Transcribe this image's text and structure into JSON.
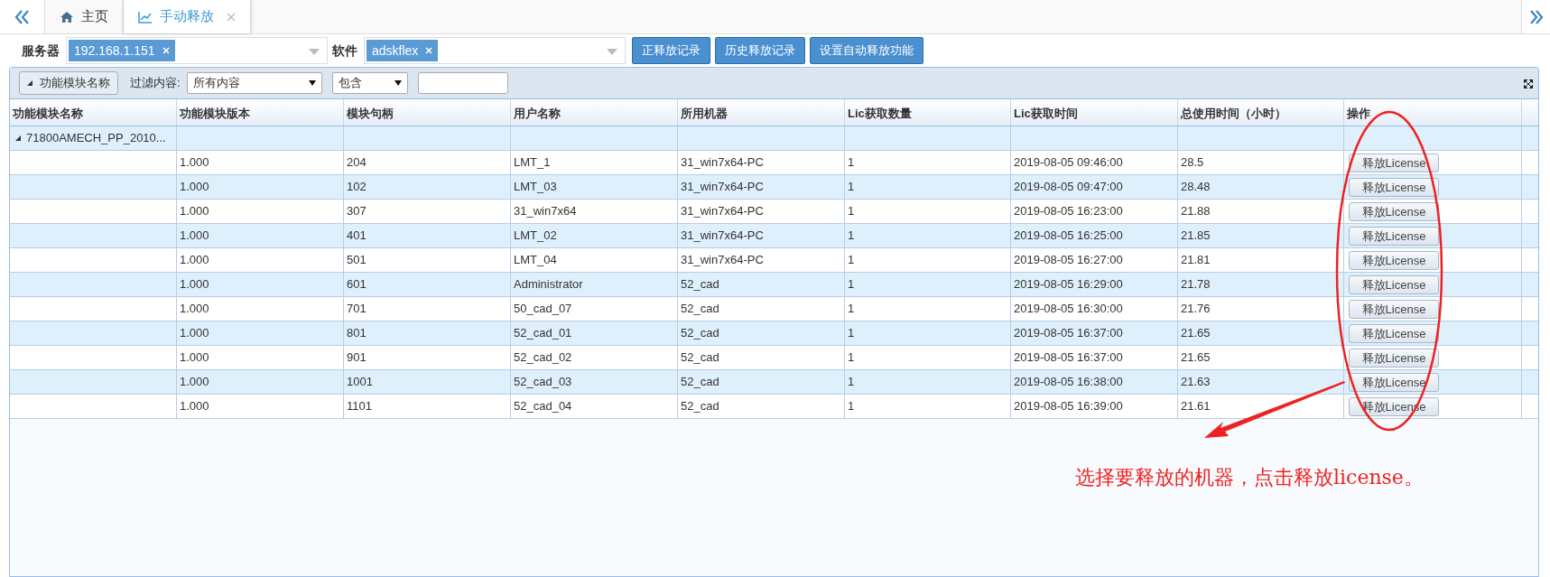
{
  "tabs": [
    {
      "label": "主页",
      "selected": false,
      "closable": false
    },
    {
      "label": "手动释放",
      "selected": true,
      "closable": true
    }
  ],
  "filters": {
    "server_label": "服务器",
    "server_tag": "192.168.1.151",
    "software_label": "软件",
    "software_tag": "adskflex",
    "buttons": [
      "正释放记录",
      "历史释放记录",
      "设置自动释放功能"
    ]
  },
  "toolbar": {
    "group_button": "功能模块名称",
    "filter_label": "过滤内容:",
    "filter_select": "所有内容",
    "match_select": "包含"
  },
  "table": {
    "columns": [
      "功能模块名称",
      "功能模块版本",
      "模块句柄",
      "用户名称",
      "所用机器",
      "Lic获取数量",
      "Lic获取时间",
      "总使用时间（小时）",
      "操作"
    ],
    "group": {
      "label": "71800AMECH_PP_2010...",
      "expanded": true
    },
    "rows": [
      {
        "cells": [
          "",
          "1.000",
          "204",
          "LMT_1",
          "31_win7x64-PC",
          "1",
          "2019-08-05 09:46:00",
          "28.5"
        ],
        "action": "释放License"
      },
      {
        "cells": [
          "",
          "1.000",
          "102",
          "LMT_03",
          "31_win7x64-PC",
          "1",
          "2019-08-05 09:47:00",
          "28.48"
        ],
        "action": "释放License"
      },
      {
        "cells": [
          "",
          "1.000",
          "307",
          "31_win7x64",
          "31_win7x64-PC",
          "1",
          "2019-08-05 16:23:00",
          "21.88"
        ],
        "action": "释放License"
      },
      {
        "cells": [
          "",
          "1.000",
          "401",
          "LMT_02",
          "31_win7x64-PC",
          "1",
          "2019-08-05 16:25:00",
          "21.85"
        ],
        "action": "释放License"
      },
      {
        "cells": [
          "",
          "1.000",
          "501",
          "LMT_04",
          "31_win7x64-PC",
          "1",
          "2019-08-05 16:27:00",
          "21.81"
        ],
        "action": "释放License"
      },
      {
        "cells": [
          "",
          "1.000",
          "601",
          "Administrator",
          "52_cad",
          "1",
          "2019-08-05 16:29:00",
          "21.78"
        ],
        "action": "释放License"
      },
      {
        "cells": [
          "",
          "1.000",
          "701",
          "50_cad_07",
          "52_cad",
          "1",
          "2019-08-05 16:30:00",
          "21.76"
        ],
        "action": "释放License"
      },
      {
        "cells": [
          "",
          "1.000",
          "801",
          "52_cad_01",
          "52_cad",
          "1",
          "2019-08-05 16:37:00",
          "21.65"
        ],
        "action": "释放License"
      },
      {
        "cells": [
          "",
          "1.000",
          "901",
          "52_cad_02",
          "52_cad",
          "1",
          "2019-08-05 16:37:00",
          "21.65"
        ],
        "action": "释放License"
      },
      {
        "cells": [
          "",
          "1.000",
          "1001",
          "52_cad_03",
          "52_cad",
          "1",
          "2019-08-05 16:38:00",
          "21.63"
        ],
        "action": "释放License"
      },
      {
        "cells": [
          "",
          "1.000",
          "1101",
          "52_cad_04",
          "52_cad",
          "1",
          "2019-08-05 16:39:00",
          "21.61"
        ],
        "action": "释放License"
      }
    ]
  },
  "annotation": "选择要释放的机器，点击释放license。"
}
